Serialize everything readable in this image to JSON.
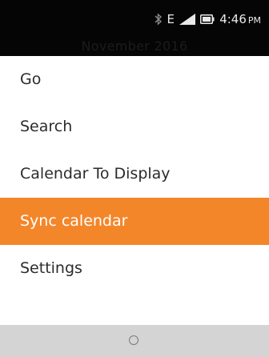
{
  "status_bar": {
    "network_type": "E",
    "time": "4:46",
    "ampm": "PM",
    "icons": [
      "bluetooth-icon",
      "signal-icon",
      "battery-icon"
    ]
  },
  "header": {
    "month_title": "November 2016"
  },
  "menu": {
    "items": [
      {
        "label": "Go"
      },
      {
        "label": "Search"
      },
      {
        "label": "Calendar To Display"
      },
      {
        "label": "Sync calendar"
      },
      {
        "label": "Settings"
      }
    ],
    "selected_index": 3,
    "selected_color": "#f4862a"
  },
  "softkeys": {
    "center_icon": "circle-icon"
  }
}
